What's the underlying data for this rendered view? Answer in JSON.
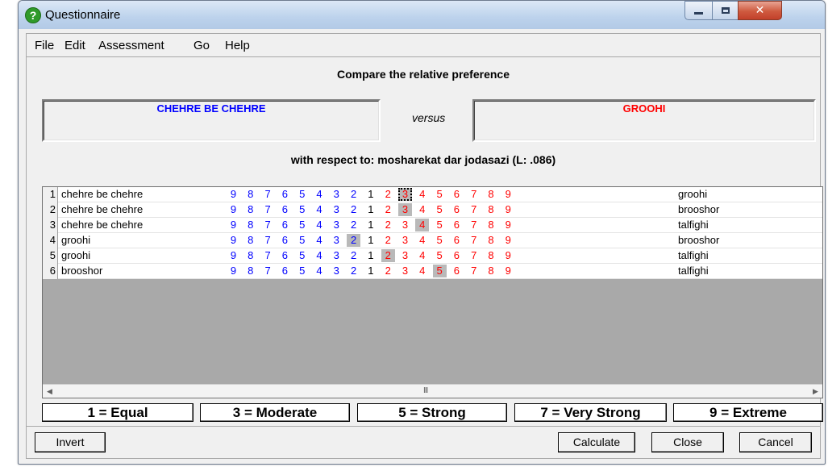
{
  "window": {
    "title": "Questionnaire",
    "icon": "help-question-icon"
  },
  "menu": [
    "File",
    "Edit",
    "Assessment",
    "Go",
    "Help"
  ],
  "heading": "Compare the relative preference",
  "left_item": {
    "text": "CHEHRE BE CHEHRE",
    "color": "#0000ff"
  },
  "versus": "versus",
  "right_item": {
    "text": "GROOHI",
    "color": "#ff0000"
  },
  "respect": "with respect to: mosharekat dar jodasazi (L: .086)",
  "scale": [
    "9",
    "8",
    "7",
    "6",
    "5",
    "4",
    "3",
    "2",
    "1",
    "2",
    "3",
    "4",
    "5",
    "6",
    "7",
    "8",
    "9"
  ],
  "rows": [
    {
      "num": "1",
      "left": "chehre be chehre",
      "right": "groohi",
      "selected_index": 10,
      "focused": true
    },
    {
      "num": "2",
      "left": "chehre be chehre",
      "right": "brooshor",
      "selected_index": 10,
      "focused": false
    },
    {
      "num": "3",
      "left": "chehre be chehre",
      "right": "talfighi",
      "selected_index": 11,
      "focused": false
    },
    {
      "num": "4",
      "left": "groohi",
      "right": "brooshor",
      "selected_index": 7,
      "focused": false
    },
    {
      "num": "5",
      "left": "groohi",
      "right": "talfighi",
      "selected_index": 9,
      "focused": false
    },
    {
      "num": "6",
      "left": "brooshor",
      "right": "talfighi",
      "selected_index": 12,
      "focused": false
    }
  ],
  "scrollbar": {
    "grip": "III"
  },
  "legend": [
    "1 = Equal",
    "3 = Moderate",
    "5 = Strong",
    "7 = Very Strong",
    "9 = Extreme"
  ],
  "buttons": {
    "invert": "Invert",
    "calculate": "Calculate",
    "close": "Close",
    "cancel": "Cancel"
  }
}
